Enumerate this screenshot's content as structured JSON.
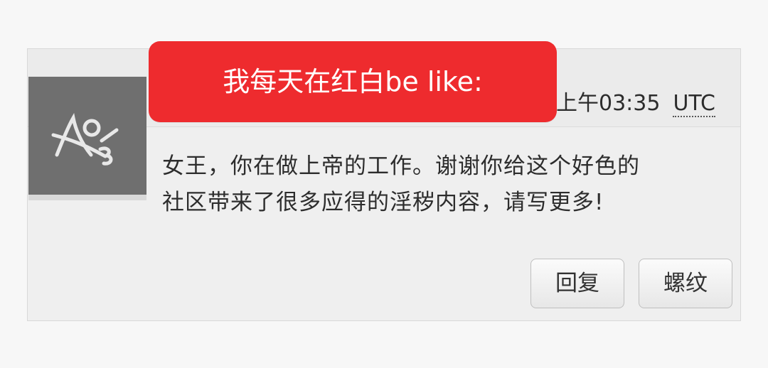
{
  "overlay": {
    "caption": "我每天在红白be like:"
  },
  "post": {
    "timestamp": "上午03:35",
    "timezone": "UTC",
    "message_line_1": "女王，你在做上帝的工作。谢谢你给这个好色的",
    "message_line_2": "社区带来了很多应得的淫秽内容，请写更多!"
  },
  "actions": {
    "reply_label": "回复",
    "thread_label": "螺纹"
  },
  "avatar": {
    "icon": "signature-logo-icon",
    "background_color": "#6f6f6f"
  },
  "colors": {
    "overlay_red": "#ee2b2e",
    "card_background": "#efefef"
  }
}
